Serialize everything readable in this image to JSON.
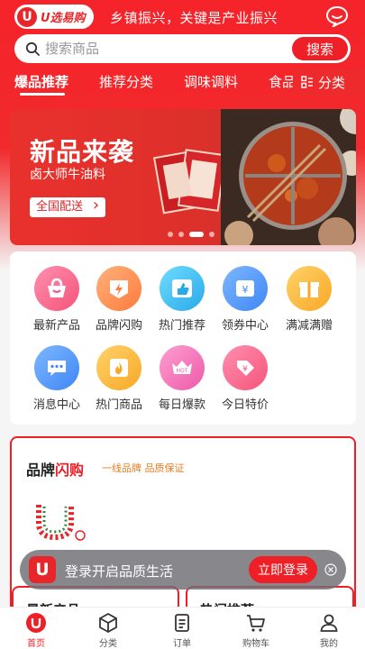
{
  "header": {
    "logo_mark": "U",
    "logo_text": "U选易购",
    "slogan": "乡镇振兴，关键是产业振兴",
    "message_icon": "chat-bubble-icon"
  },
  "search": {
    "placeholder": "搜索商品",
    "button": "搜索"
  },
  "tabs": [
    {
      "label": "爆品推荐",
      "active": true
    },
    {
      "label": "推荐分类",
      "active": false
    },
    {
      "label": "调味调料",
      "active": false
    },
    {
      "label": "食品",
      "active": false
    }
  ],
  "category_button": "分类",
  "banner": {
    "title": "新品来袭",
    "subtitle": "卤大师牛油料",
    "cta": "全国配送",
    "slide_count": 4,
    "active_slide": 3
  },
  "grid": [
    {
      "label": "最新产品",
      "icon": "basket-icon",
      "color": "#f5638a"
    },
    {
      "label": "品牌闪购",
      "icon": "lightning-gem-icon",
      "color": "#ff8a55"
    },
    {
      "label": "热门推荐",
      "icon": "thumbs-up-icon",
      "color": "#3cc2f0"
    },
    {
      "label": "领券中心",
      "icon": "coupon-icon",
      "color": "#4a9ef8"
    },
    {
      "label": "满减满赠",
      "icon": "gift-icon",
      "color": "#fcb940"
    },
    {
      "label": "消息中心",
      "icon": "message-icon",
      "color": "#4a9ef8"
    },
    {
      "label": "热门商品",
      "icon": "fire-icon",
      "color": "#fcb940"
    },
    {
      "label": "每日爆款",
      "icon": "hot-crown-icon",
      "color": "#f06eb4"
    },
    {
      "label": "今日特价",
      "icon": "price-tag-icon",
      "color": "#f5638a"
    }
  ],
  "brand_flash": {
    "title_a": "品牌",
    "title_b": "闪购",
    "tagline": "一线品牌 品质保证"
  },
  "sections": {
    "latest": "最新产品",
    "hot": "热门推荐"
  },
  "login_prompt": {
    "logo": "U",
    "text": "登录开启品质生活",
    "button": "立即登录"
  },
  "bottom_nav": [
    {
      "label": "首页",
      "icon": "home-icon",
      "active": true
    },
    {
      "label": "分类",
      "icon": "cube-icon",
      "active": false
    },
    {
      "label": "订单",
      "icon": "order-icon",
      "active": false
    },
    {
      "label": "购物车",
      "icon": "cart-icon",
      "active": false
    },
    {
      "label": "我的",
      "icon": "user-icon",
      "active": false
    }
  ],
  "colors": {
    "brand_red": "#ef1f27"
  }
}
